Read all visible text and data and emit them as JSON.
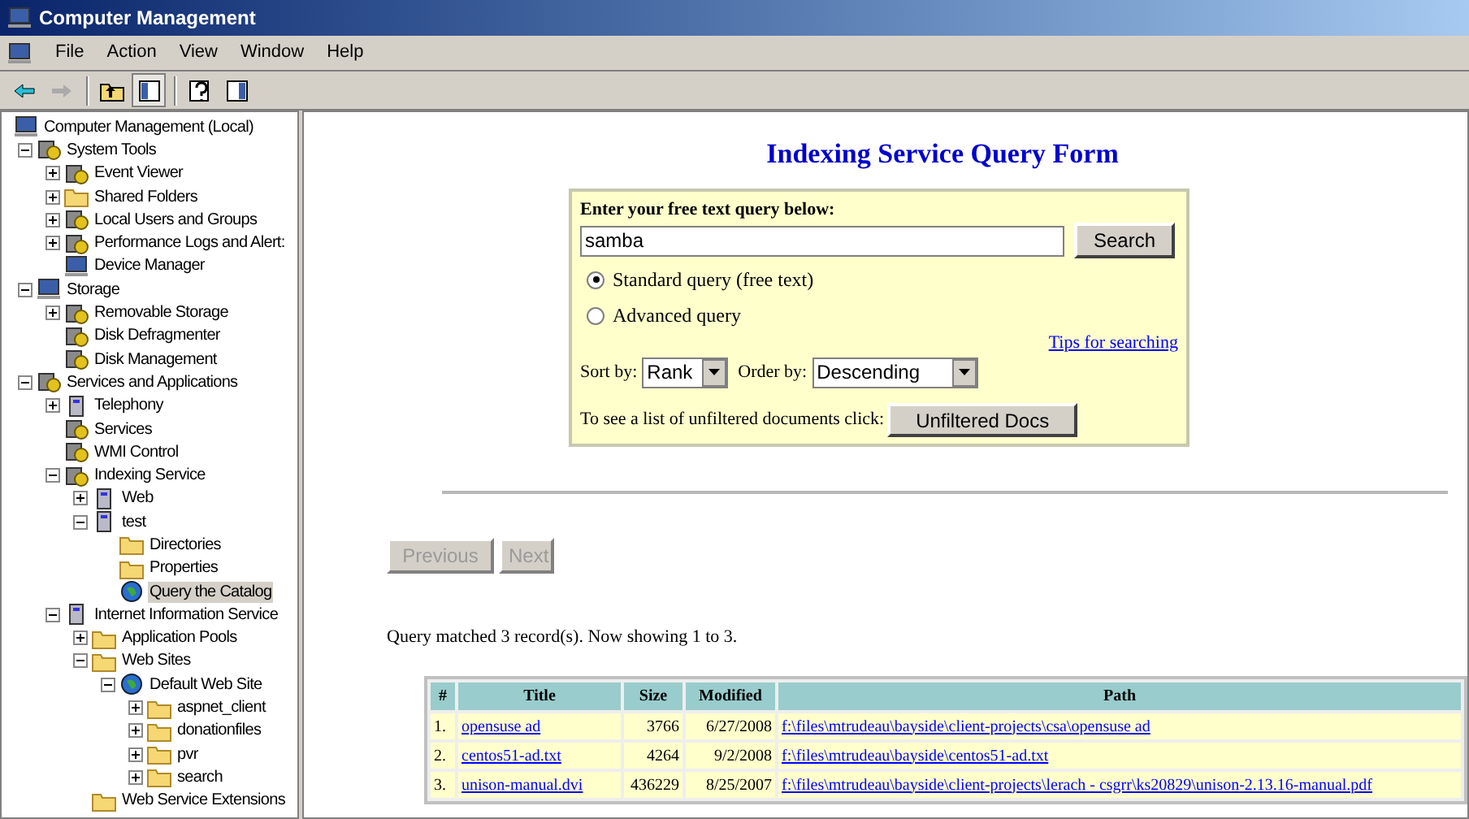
{
  "window": {
    "title": "Computer Management"
  },
  "menu": [
    "File",
    "Action",
    "View",
    "Window",
    "Help"
  ],
  "toolbar": [
    {
      "kind": "back",
      "disabled": false
    },
    {
      "kind": "forward",
      "disabled": true
    },
    {
      "kind": "up",
      "disabled": false
    },
    {
      "kind": "tree",
      "disabled": false
    },
    {
      "kind": "help",
      "disabled": false
    },
    {
      "kind": "panel",
      "disabled": false
    }
  ],
  "tree": {
    "label": "Computer Management (Local)",
    "kind": "computer",
    "selected": false,
    "children": [
      {
        "label": "System Tools",
        "kind": "tools",
        "expanded": true,
        "selected": false,
        "children": [
          {
            "label": "Event Viewer",
            "kind": "tools",
            "expanded": false,
            "selected": false
          },
          {
            "label": "Shared Folders",
            "kind": "folder",
            "expanded": false,
            "selected": false
          },
          {
            "label": "Local Users and Groups",
            "kind": "tools",
            "expanded": false,
            "selected": false
          },
          {
            "label": "Performance Logs and Alert:",
            "kind": "tools",
            "expanded": false,
            "selected": false
          },
          {
            "label": "Device Manager",
            "kind": "computer",
            "selected": false
          }
        ]
      },
      {
        "label": "Storage",
        "kind": "computer",
        "expanded": true,
        "selected": false,
        "children": [
          {
            "label": "Removable Storage",
            "kind": "tools",
            "expanded": false,
            "selected": false
          },
          {
            "label": "Disk Defragmenter",
            "kind": "tools",
            "selected": false
          },
          {
            "label": "Disk Management",
            "kind": "tools",
            "selected": false
          }
        ]
      },
      {
        "label": "Services and Applications",
        "kind": "tools",
        "expanded": true,
        "selected": false,
        "children": [
          {
            "label": "Telephony",
            "kind": "server",
            "expanded": false,
            "selected": false
          },
          {
            "label": "Services",
            "kind": "tools",
            "selected": false
          },
          {
            "label": "WMI Control",
            "kind": "tools",
            "selected": false
          },
          {
            "label": "Indexing Service",
            "kind": "tools",
            "expanded": true,
            "selected": false,
            "children": [
              {
                "label": "Web",
                "kind": "server",
                "expanded": false,
                "selected": false
              },
              {
                "label": "test",
                "kind": "server",
                "expanded": true,
                "selected": false,
                "children": [
                  {
                    "label": "Directories",
                    "kind": "folder",
                    "selected": false
                  },
                  {
                    "label": "Properties",
                    "kind": "folder",
                    "selected": false
                  },
                  {
                    "label": "Query the Catalog",
                    "kind": "globe",
                    "selected": true
                  }
                ]
              }
            ]
          },
          {
            "label": "Internet Information Service",
            "kind": "server",
            "expanded": true,
            "selected": false,
            "children": [
              {
                "label": "Application Pools",
                "kind": "folder",
                "expanded": false,
                "selected": false
              },
              {
                "label": "Web Sites",
                "kind": "folder",
                "expanded": true,
                "selected": false,
                "children": [
                  {
                    "label": "Default Web Site",
                    "kind": "globe",
                    "expanded": true,
                    "selected": false,
                    "children": [
                      {
                        "label": "aspnet_client",
                        "kind": "folder",
                        "expanded": false,
                        "selected": false
                      },
                      {
                        "label": "donationfiles",
                        "kind": "folder",
                        "expanded": false,
                        "selected": false
                      },
                      {
                        "label": "pvr",
                        "kind": "folder",
                        "expanded": false,
                        "selected": false
                      },
                      {
                        "label": "search",
                        "kind": "folder",
                        "expanded": false,
                        "selected": false
                      }
                    ]
                  }
                ]
              },
              {
                "label": "Web Service Extensions",
                "kind": "folder",
                "selected": false
              }
            ]
          }
        ]
      }
    ]
  },
  "page": {
    "heading": "Indexing Service Query Form",
    "form": {
      "prompt": "Enter your free text query below:",
      "query": "samba",
      "search_button": "Search",
      "modes": [
        {
          "label": "Standard query (free text)",
          "selected": true
        },
        {
          "label": "Advanced query",
          "selected": false
        }
      ],
      "tips_link": "Tips for searching",
      "sort_label": "Sort by:",
      "sort_value": "Rank",
      "order_label": "Order by:",
      "order_value": "Descending",
      "unfiltered_text": "To see a list of unfiltered documents click:",
      "unfiltered_button": "Unfiltered Docs"
    },
    "nav": [
      {
        "label": "Previous",
        "disabled": true
      },
      {
        "label": "Next",
        "disabled": true
      }
    ],
    "summary": "Query matched 3 record(s). Now showing 1 to 3.",
    "table": {
      "columns": [
        "#",
        "Title",
        "Size",
        "Modified",
        "Path"
      ],
      "rows": [
        [
          "1.",
          "opensuse ad",
          "3766",
          "6/27/2008",
          "f:\\files\\mtrudeau\\bayside\\client-projects\\csa\\opensuse ad"
        ],
        [
          "2.",
          "centos51-ad.txt",
          "4264",
          "9/2/2008",
          "f:\\files\\mtrudeau\\bayside\\centos51-ad.txt"
        ],
        [
          "3.",
          "unison-manual.dvi",
          "436229",
          "8/25/2007",
          "f:\\files\\mtrudeau\\bayside\\client-projects\\lerach - csgrr\\ks20829\\unison-2.13.16-manual.pdf"
        ]
      ]
    }
  }
}
